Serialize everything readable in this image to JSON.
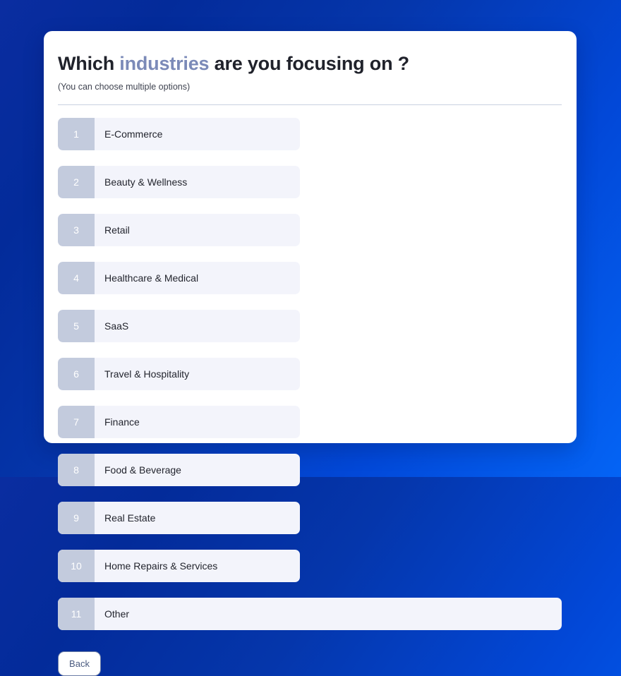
{
  "background": {
    "gradient_from": "#032b9a",
    "gradient_to": "#0464f5"
  },
  "card": {
    "title": {
      "before": "Which ",
      "highlight": "industries",
      "after": " are you focusing on ?",
      "highlight_color": "#7b8ab8",
      "text_color": "#20222b"
    },
    "subtitle": "(You can choose multiple options)",
    "options": [
      {
        "number": "1",
        "label": "E-Commerce"
      },
      {
        "number": "2",
        "label": "Beauty & Wellness"
      },
      {
        "number": "3",
        "label": "Retail"
      },
      {
        "number": "4",
        "label": "Healthcare & Medical"
      },
      {
        "number": "5",
        "label": "SaaS"
      },
      {
        "number": "6",
        "label": "Travel & Hospitality"
      },
      {
        "number": "7",
        "label": "Finance"
      },
      {
        "number": "8",
        "label": "Food & Beverage"
      },
      {
        "number": "9",
        "label": "Real Estate"
      },
      {
        "number": "10",
        "label": "Home Repairs & Services"
      },
      {
        "number": "11",
        "label": "Other"
      }
    ],
    "option_colors": {
      "badge_background": "#c3cbdd",
      "badge_text": "#ffffff",
      "row_background": "#f3f4fb",
      "label_text": "#23252e"
    },
    "footer": {
      "back_label": "Back",
      "back_border_color": "#6b7da6",
      "back_text_color": "#4b5b80"
    }
  }
}
